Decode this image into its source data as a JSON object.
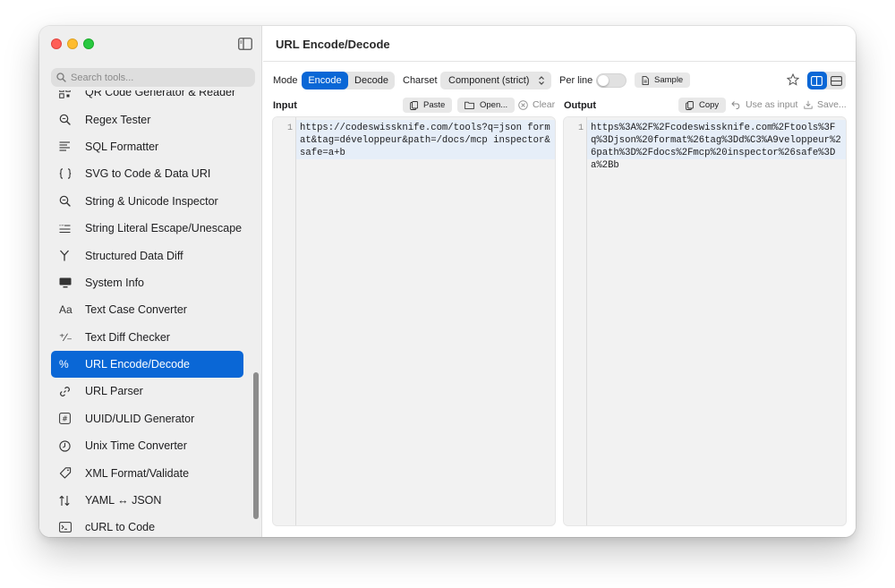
{
  "window": {
    "title": "URL Encode/Decode"
  },
  "sidebar": {
    "search_placeholder": "Search tools...",
    "items": [
      {
        "label": "QR Code Generator & Reader",
        "icon": "qr-icon"
      },
      {
        "label": "Regex Tester",
        "icon": "magnifier-icon"
      },
      {
        "label": "SQL Formatter",
        "icon": "lines-icon"
      },
      {
        "label": "SVG to Code & Data URI",
        "icon": "braces-icon"
      },
      {
        "label": "String & Unicode Inspector",
        "icon": "magnifier-icon"
      },
      {
        "label": "String Literal Escape/Unescape",
        "icon": "escape-icon"
      },
      {
        "label": "Structured Data Diff",
        "icon": "fork-icon"
      },
      {
        "label": "System Info",
        "icon": "monitor-icon"
      },
      {
        "label": "Text Case Converter",
        "icon": "aa-icon",
        "glyph": "Aa"
      },
      {
        "label": "Text Diff Checker",
        "icon": "plus-minus-icon",
        "glyph": "⁺∕₋"
      },
      {
        "label": "URL Encode/Decode",
        "icon": "percent-icon",
        "glyph": "%",
        "active": true
      },
      {
        "label": "URL Parser",
        "icon": "link-icon"
      },
      {
        "label": "UUID/ULID Generator",
        "icon": "hash-icon",
        "glyph": "#"
      },
      {
        "label": "Unix Time Converter",
        "icon": "clock-icon"
      },
      {
        "label": "XML Format/Validate",
        "icon": "tag-icon"
      },
      {
        "label": "YAML ↔ JSON",
        "icon": "swap-icon"
      },
      {
        "label": "cURL to Code",
        "icon": "terminal-icon"
      }
    ]
  },
  "toolbar": {
    "mode_label": "Mode",
    "mode_encode": "Encode",
    "mode_decode": "Decode",
    "charset_label": "Charset",
    "charset_value": "Component (strict)",
    "perline_label": "Per line",
    "sample_label": "Sample"
  },
  "input": {
    "title": "Input",
    "paste": "Paste",
    "open": "Open...",
    "clear": "Clear",
    "line_number": "1",
    "text": "https://codeswissknife.com/tools?q=json format&tag=développeur&path=/docs/mcp inspector&safe=a+b"
  },
  "output": {
    "title": "Output",
    "copy": "Copy",
    "use_as_input": "Use as input",
    "save": "Save...",
    "line_number": "1",
    "text": "https%3A%2F%2Fcodeswissknife.com%2Ftools%3Fq%3Djson%20format%26tag%3Dd%C3%A9veloppeur%26path%3D%2Fdocs%2Fmcp%20inspector%26safe%3Da%2Bb"
  },
  "colors": {
    "accent": "#0a67d6",
    "close": "#ff5f57",
    "minimize": "#febc2e",
    "zoom": "#28c840"
  }
}
